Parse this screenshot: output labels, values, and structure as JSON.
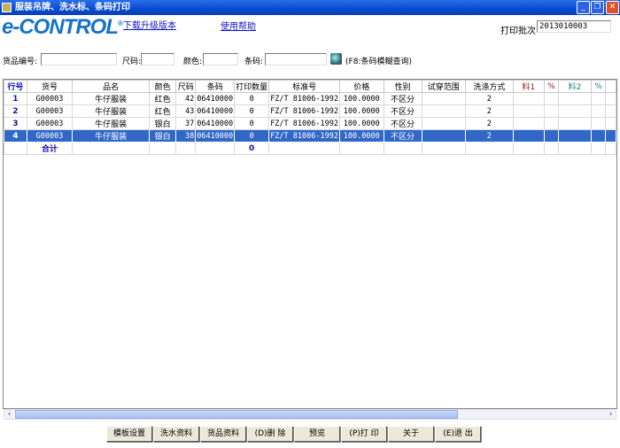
{
  "window": {
    "title": "服装吊牌、洗水标、条码打印",
    "minimize": "_",
    "restore": "❐",
    "close": "✕"
  },
  "header": {
    "logo": "e-CONTROL",
    "logo_mark": "®",
    "download_link": "下载升级版本",
    "help_link": "使用帮助",
    "batch_label": "打印批次",
    "batch_value": "2013010003"
  },
  "filters": {
    "product_code_label": "货品编号:",
    "product_code_value": "",
    "size_label": "尺码:",
    "size_value": "",
    "color_label": "颜色:",
    "color_value": "",
    "barcode_label": "条码:",
    "barcode_value": "",
    "search_icon": "search-icon",
    "hint": "(F8:条码模糊查询)"
  },
  "grid": {
    "columns": [
      "行号",
      "货号",
      "品名",
      "颜色",
      "尺码",
      "条码",
      "打印数量",
      "标准号",
      "价格",
      "性别",
      "试穿范围",
      "洗涤方式",
      "料1",
      "%",
      "料2",
      "%",
      ""
    ],
    "column_colors": {
      "料1": "#a02020",
      "料2": "#208080",
      "%1": "#a02020",
      "%2": "#208080"
    },
    "rows": [
      {
        "row": "1",
        "code": "G00003",
        "name": "牛仔服装",
        "color": "红色",
        "size": "42",
        "barcode": "06410000",
        "qty": "0",
        "standard": "FZ/T 81006-1992",
        "price": "100.0000",
        "gender": "不区分",
        "fit": "",
        "wash": "2",
        "m1": "",
        "p1": "",
        "m2": "",
        "p2": ""
      },
      {
        "row": "2",
        "code": "G00003",
        "name": "牛仔服装",
        "color": "红色",
        "size": "43",
        "barcode": "06410000",
        "qty": "0",
        "standard": "FZ/T 81006-1992",
        "price": "100.0000",
        "gender": "不区分",
        "fit": "",
        "wash": "2",
        "m1": "",
        "p1": "",
        "m2": "",
        "p2": ""
      },
      {
        "row": "3",
        "code": "G00003",
        "name": "牛仔服装",
        "color": "银白",
        "size": "37",
        "barcode": "06410000",
        "qty": "0",
        "standard": "FZ/T 81006-1992",
        "price": "100.0000",
        "gender": "不区分",
        "fit": "",
        "wash": "2",
        "m1": "",
        "p1": "",
        "m2": "",
        "p2": ""
      },
      {
        "row": "4",
        "code": "G00003",
        "name": "牛仔服装",
        "color": "银白",
        "size": "38",
        "barcode": "06410000",
        "qty": "0",
        "standard": "FZ/T 81006-1992",
        "price": "100.0000",
        "gender": "不区分",
        "fit": "",
        "wash": "2",
        "m1": "",
        "p1": "",
        "m2": "",
        "p2": "",
        "selected": true
      }
    ],
    "total_label": "合计",
    "total_qty": "0",
    "selection_color": "#3168c8"
  },
  "buttons": [
    {
      "label": "模板设置"
    },
    {
      "label": "洗水资料"
    },
    {
      "label": "货品资料"
    },
    {
      "label": "(D)删 除"
    },
    {
      "label": "预览"
    },
    {
      "label": "(P)打 印"
    },
    {
      "label": "关于"
    },
    {
      "label": "(E)退 出"
    }
  ]
}
